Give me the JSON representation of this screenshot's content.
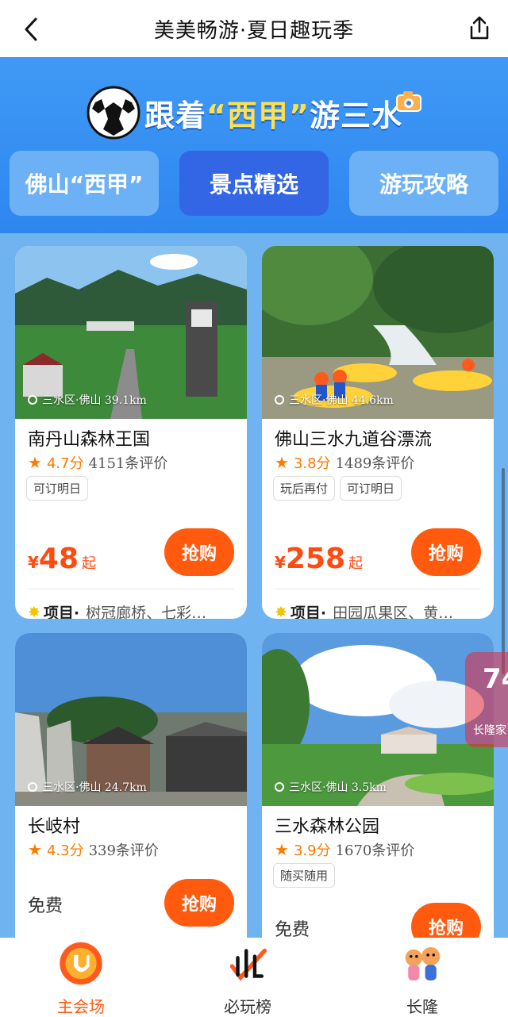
{
  "header": {
    "title": "美美畅游·夏日趣玩季"
  },
  "banner": {
    "headline_part1": "跟着",
    "headline_quoted": "“西甲”",
    "headline_part2": "游三水",
    "tabs": [
      {
        "label": "佛山“西甲”"
      },
      {
        "label": "景点精选"
      },
      {
        "label": "游玩攻略"
      }
    ]
  },
  "cards": [
    {
      "location": "三水区·佛山 39.1km",
      "name": "南丹山森林王国",
      "score": "4.7分",
      "reviews": "4151条评价",
      "tags": [
        "可订明日"
      ],
      "currency": "¥",
      "price": "48",
      "price_suffix": "起",
      "buy_label": "抢购",
      "items_label": "项目·",
      "items_value": "树冠廊桥、七彩…"
    },
    {
      "location": "三水区·佛山 44.6km",
      "name": "佛山三水九道谷漂流",
      "score": "3.8分",
      "reviews": "1489条评价",
      "tags": [
        "玩后再付",
        "可订明日"
      ],
      "currency": "¥",
      "price": "258",
      "price_suffix": "起",
      "buy_label": "抢购",
      "items_label": "项目·",
      "items_value": "田园瓜果区、黄…"
    },
    {
      "location": "三水区·佛山 24.7km",
      "name": "长岐村",
      "score": "4.3分",
      "reviews": "339条评价",
      "tags": [],
      "free_label": "免费",
      "buy_label": "抢购"
    },
    {
      "location": "三水区·佛山 3.5km",
      "name": "三水森林公园",
      "score": "3.9分",
      "reviews": "1670条评价",
      "tags": [
        "随买随用"
      ],
      "free_label": "免费",
      "buy_label": "抢购"
    }
  ],
  "float_badge": {
    "number": "74",
    "text": "长隆家"
  },
  "bottom_nav": [
    {
      "label": "主会场"
    },
    {
      "label": "必玩榜"
    },
    {
      "label": "长隆"
    }
  ],
  "colors": {
    "accent": "#ff5a0e",
    "banner": "#2e86ef",
    "page_bg": "#6fb4f0"
  }
}
